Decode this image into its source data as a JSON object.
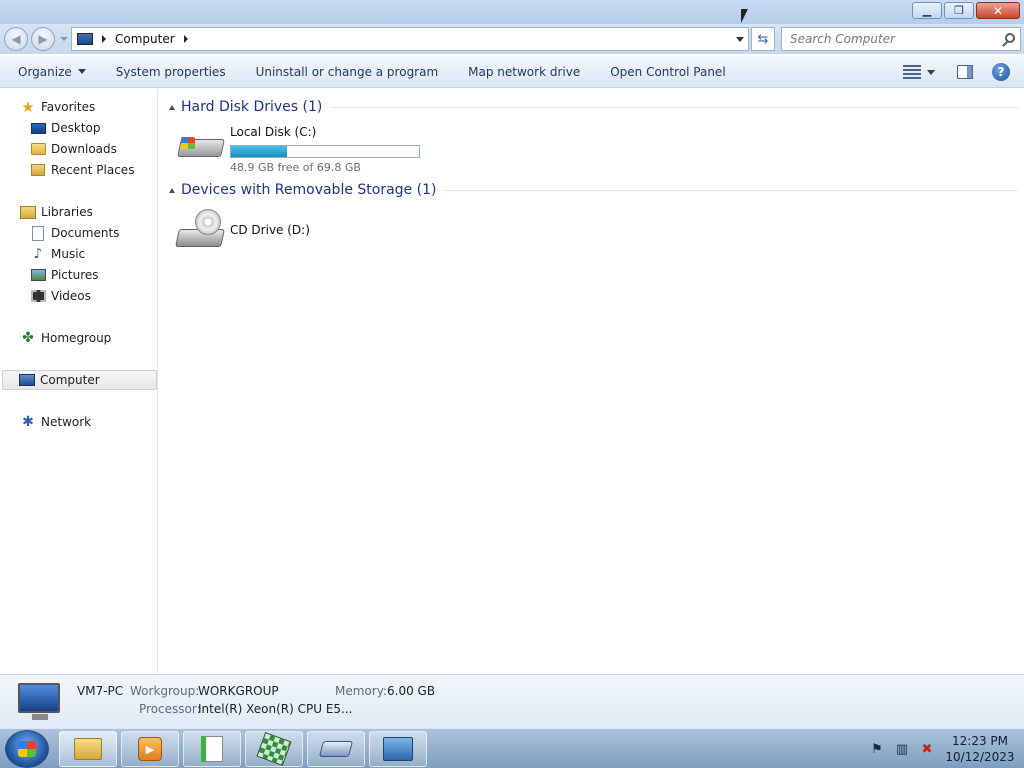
{
  "window": {
    "minimize_glyph": "▁",
    "maximize_glyph": "❐",
    "close_glyph": "✕"
  },
  "address": {
    "location": "Computer",
    "search_placeholder": "Search Computer"
  },
  "toolbar": {
    "organize_label": "Organize",
    "system_properties_label": "System properties",
    "uninstall_label": "Uninstall or change a program",
    "map_network_label": "Map network drive",
    "control_panel_label": "Open Control Panel",
    "help_glyph": "?"
  },
  "sidebar": {
    "favorites": "Favorites",
    "desktop": "Desktop",
    "downloads": "Downloads",
    "recent_places": "Recent Places",
    "libraries": "Libraries",
    "documents": "Documents",
    "music": "Music",
    "pictures": "Pictures",
    "videos": "Videos",
    "homegroup": "Homegroup",
    "computer": "Computer",
    "network": "Network"
  },
  "content": {
    "hard_disk_group": "Hard Disk Drives (1)",
    "removable_group": "Devices with Removable Storage (1)",
    "drives": [
      {
        "name": "Local Disk (C:)",
        "free_text": "48.9 GB free of 69.8 GB",
        "used_fraction": 0.3
      },
      {
        "name": "CD Drive (D:)"
      }
    ]
  },
  "details": {
    "pc_name": "VM7-PC",
    "workgroup_label": "Workgroup:",
    "workgroup_value": "WORKGROUP",
    "memory_label": "Memory:",
    "memory_value": "6.00 GB",
    "processor_label": "Processor:",
    "processor_value": "Intel(R) Xeon(R) CPU E5..."
  },
  "taskbar": {
    "time": "12:23 PM",
    "date": "10/12/2023"
  },
  "colors": {
    "group_title": "#1e3287",
    "capacity_fill": "#26a5d6",
    "titlebar": "#c9dcf2"
  }
}
